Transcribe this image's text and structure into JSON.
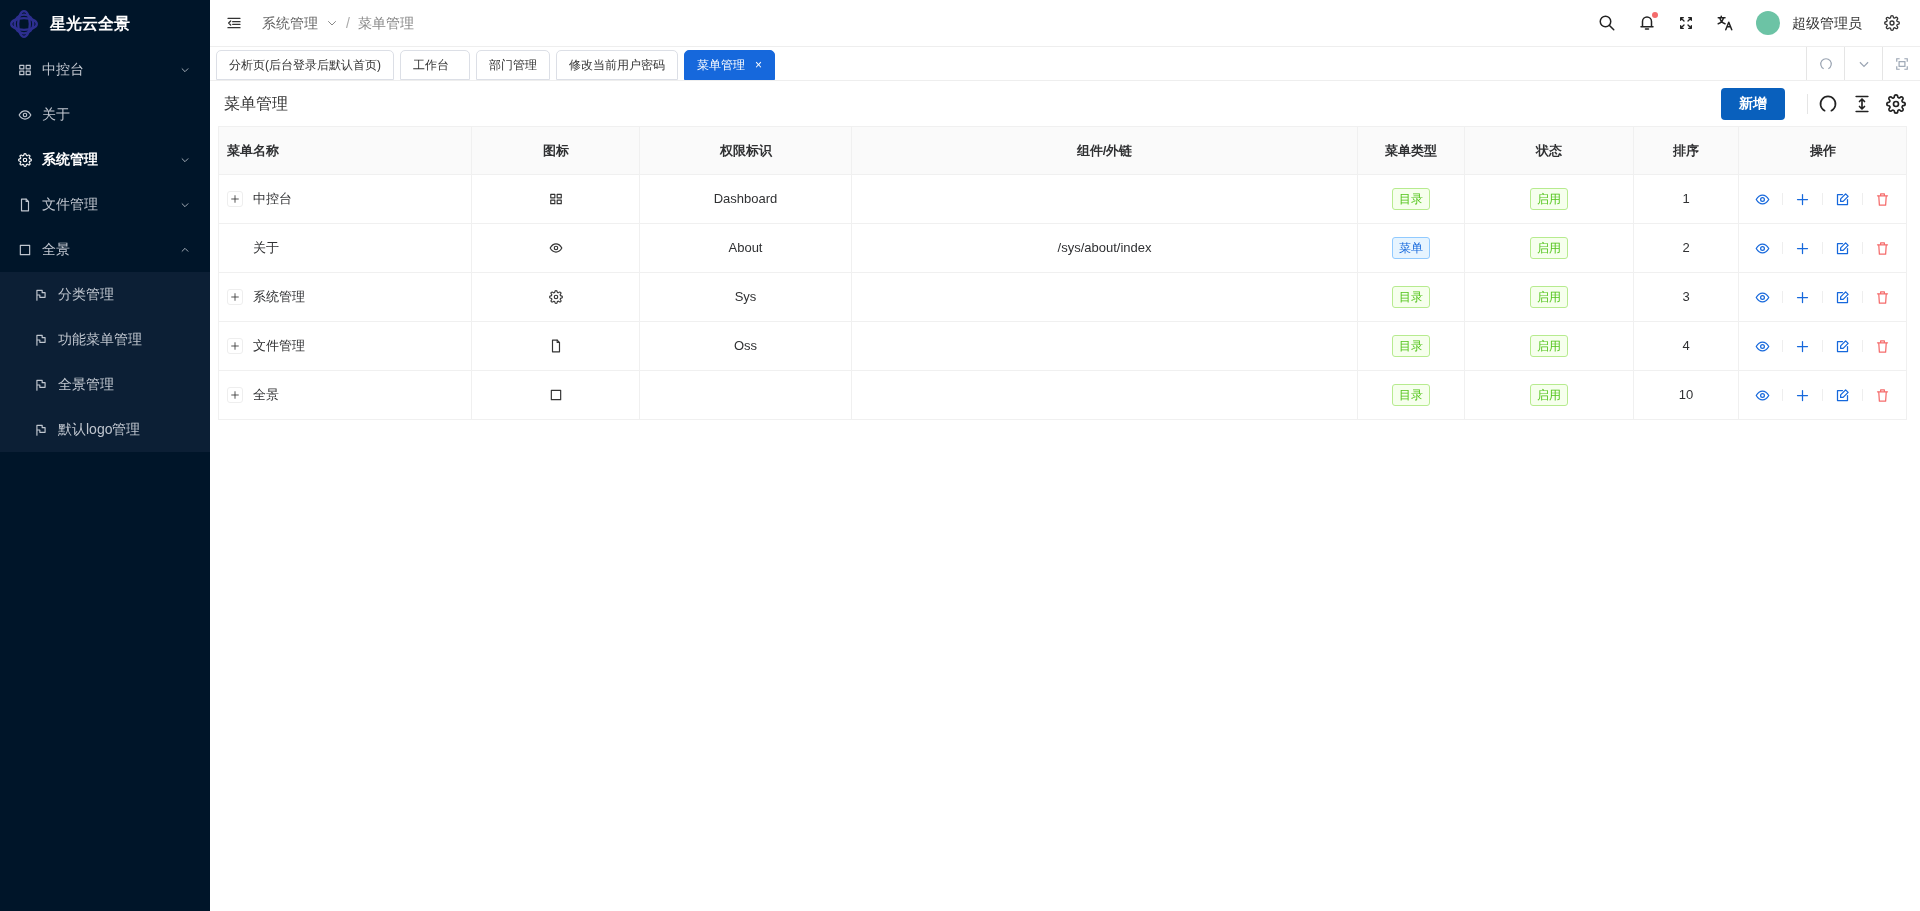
{
  "sidebar": {
    "logo_text": "星光云全景",
    "items": [
      {
        "label": "中控台",
        "selected": false,
        "expanded": false
      },
      {
        "label": "关于",
        "selected": false
      },
      {
        "label": "系统管理",
        "selected": true,
        "expanded": false
      },
      {
        "label": "文件管理",
        "selected": false,
        "expanded": false
      },
      {
        "label": "全景",
        "selected": false,
        "expanded": true,
        "children": [
          {
            "label": "分类管理",
            "selected": false
          },
          {
            "label": "功能菜单管理",
            "selected": false
          },
          {
            "label": "全景管理",
            "selected": false
          },
          {
            "label": "默认logo管理",
            "selected": false
          }
        ]
      }
    ]
  },
  "header": {
    "breadcrumb": [
      "系统管理",
      "菜单管理"
    ],
    "breadcrumb_separator": "/",
    "notification_dot": true,
    "user_name": "超级管理员"
  },
  "tabs": [
    {
      "label": "分析页(后台登录后默认首页)",
      "selected": false
    },
    {
      "label": "工作台",
      "selected": false
    },
    {
      "label": "部门管理",
      "selected": false
    },
    {
      "label": "修改当前用户密码",
      "selected": false
    },
    {
      "label": "菜单管理",
      "selected": true,
      "close": "×"
    }
  ],
  "page": {
    "title": "菜单管理",
    "add_button": "新增"
  },
  "table": {
    "columns": [
      "菜单名称",
      "图标",
      "权限标识",
      "组件/外链",
      "菜单类型",
      "状态",
      "排序",
      "操作"
    ],
    "rows": [
      {
        "name": "中控台",
        "expandable": true,
        "permission": "Dashboard",
        "component": "",
        "type": "目录",
        "kind": "directory",
        "status": "启用",
        "order": "1"
      },
      {
        "name": "关于",
        "expandable": false,
        "permission": "About",
        "component": "/sys/about/index",
        "type": "菜单",
        "kind": "menu",
        "status": "启用",
        "order": "2"
      },
      {
        "name": "系统管理",
        "expandable": true,
        "permission": "Sys",
        "component": "",
        "type": "目录",
        "kind": "directory",
        "status": "启用",
        "order": "3"
      },
      {
        "name": "文件管理",
        "expandable": true,
        "permission": "Oss",
        "component": "",
        "type": "目录",
        "kind": "directory",
        "status": "启用",
        "order": "4"
      },
      {
        "name": "全景",
        "expandable": true,
        "permission": "",
        "component": "",
        "type": "目录",
        "kind": "directory",
        "status": "启用",
        "order": "10"
      }
    ]
  }
}
